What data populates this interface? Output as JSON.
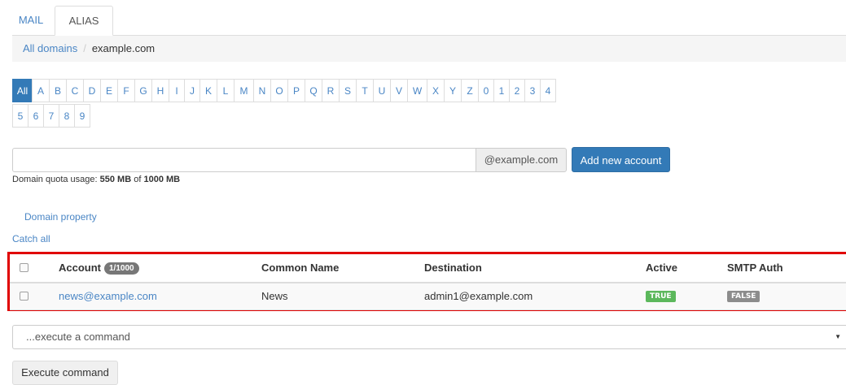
{
  "tabs": [
    {
      "label": "MAIL"
    },
    {
      "label": "ALIAS"
    }
  ],
  "breadcrumb": {
    "root": "All domains",
    "separator": "/",
    "current": "example.com"
  },
  "letters": [
    "All",
    "A",
    "B",
    "C",
    "D",
    "E",
    "F",
    "G",
    "H",
    "I",
    "J",
    "K",
    "L",
    "M",
    "N",
    "O",
    "P",
    "Q",
    "R",
    "S",
    "T",
    "U",
    "V",
    "W",
    "X",
    "Y",
    "Z",
    "0",
    "1",
    "2",
    "3",
    "4",
    "5",
    "6",
    "7",
    "8",
    "9"
  ],
  "selected_letter": "All",
  "new_account": {
    "value": "",
    "domain_suffix": "@example.com",
    "add_button": "Add new account"
  },
  "quota": {
    "prefix": "Domain quota usage:",
    "used": "550 MB",
    "of": "of",
    "total": "1000 MB"
  },
  "links": {
    "domain_property": "Domain property",
    "catch_all": "Catch all"
  },
  "table": {
    "headers": {
      "account": "Account",
      "count_badge": "1/1000",
      "common_name": "Common Name",
      "destination": "Destination",
      "active": "Active",
      "smtp_auth": "SMTP Auth"
    },
    "rows": [
      {
        "account": "news@example.com",
        "common_name": "News",
        "destination": "admin1@example.com",
        "active": "TRUE",
        "smtp_auth": "FALSE"
      }
    ]
  },
  "command": {
    "placeholder": "...execute a command",
    "button": "Execute command"
  },
  "colors": {
    "primary": "#337ab7",
    "link": "#4a86c5",
    "true_badge": "#5cb85c",
    "false_badge": "#8c8c8c",
    "highlight_border": "#e00000"
  }
}
